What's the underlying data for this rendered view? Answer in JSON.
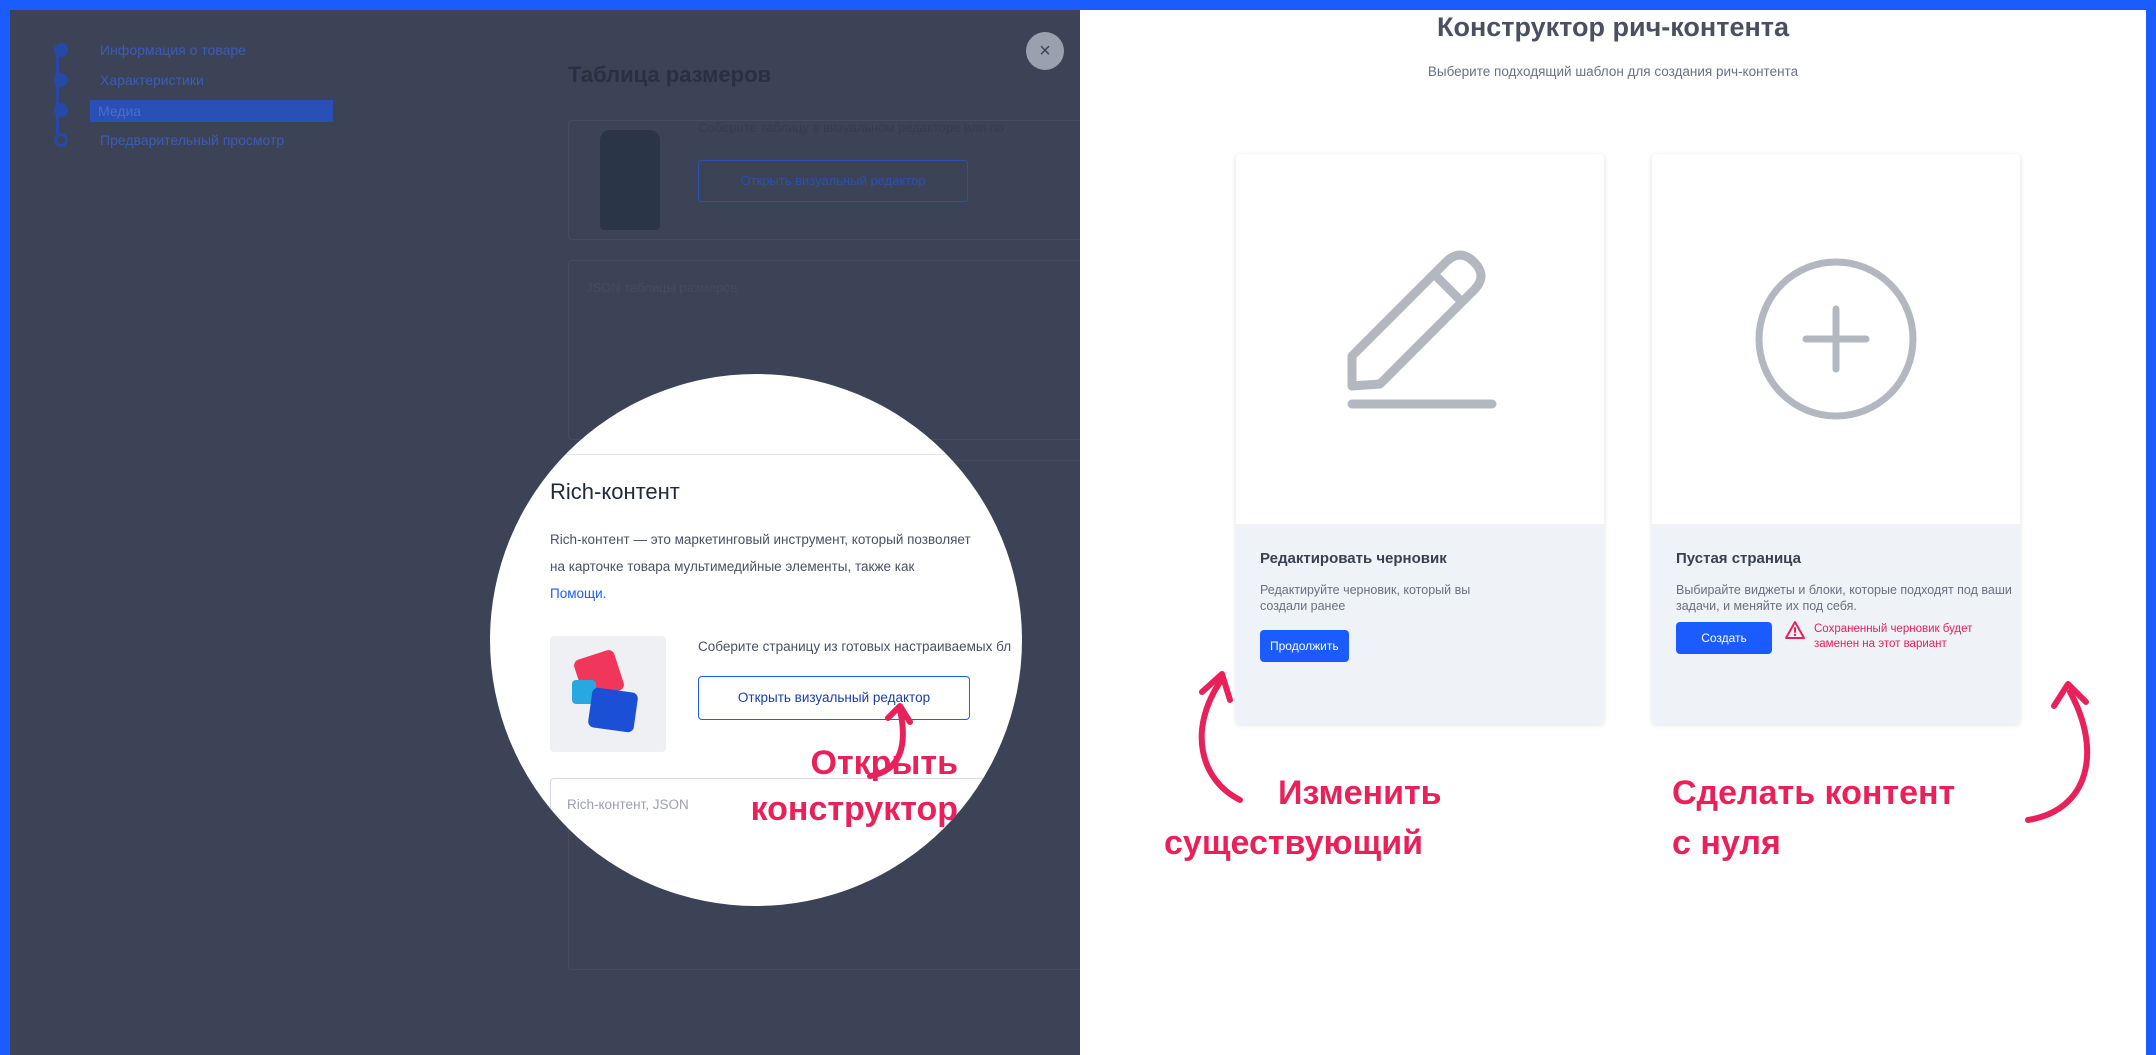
{
  "background_page": {
    "steps": [
      {
        "label": "Информация о товаре"
      },
      {
        "label": "Характеристики"
      },
      {
        "label": "Медиа"
      },
      {
        "label": "Предварительный просмотр"
      }
    ],
    "close_label": "×",
    "size_table": {
      "title": "Таблица размеров",
      "text": "Соберите таблицу в визуальном редакторе или по",
      "button": "Открыть визуальный редактор",
      "json_placeholder": "JSON таблицы размеров"
    }
  },
  "magnifier": {
    "title": "Rich-контент",
    "desc_line1": "Rich-контент — это маркетинговый инструмент, который позволяет",
    "desc_line2": "на карточке товара мультимедийные элементы, также как",
    "desc_link": "Помощи.",
    "text": "Соберите страницу из готовых настраиваемых бл",
    "button": "Открыть визуальный редактор",
    "json_placeholder": "Rich-контент, JSON",
    "annotation_line1": "Открыть",
    "annotation_line2": "конструктор"
  },
  "constructor": {
    "title": "Конструктор рич-контента",
    "subtitle": "Выберите подходящий шаблон для создания рич-контента",
    "cards": [
      {
        "name": "Редактировать черновик",
        "description": "Редактируйте черновик, который вы создали ранее",
        "button": "Продолжить",
        "icon": "pencil-icon"
      },
      {
        "name": "Пустая страница",
        "description": "Выбирайте виджеты и блоки, которые подходят под ваши задачи, и меняйте их под себя.",
        "button": "Создать",
        "icon": "plus-circle-icon",
        "warning": "Сохраненный черновик будет заменен на этот вариант",
        "warning_icon": "warning-triangle-icon"
      }
    ],
    "annotation_left_line1": "Изменить",
    "annotation_left_line2": "существующий",
    "annotation_right_line1": "Сделать контент",
    "annotation_right_line2": "с нуля"
  },
  "colors": {
    "frame": "#1a5cff",
    "overlay": "#3c4356",
    "accent": "#1a5cff",
    "annotation": "#e8215a"
  }
}
